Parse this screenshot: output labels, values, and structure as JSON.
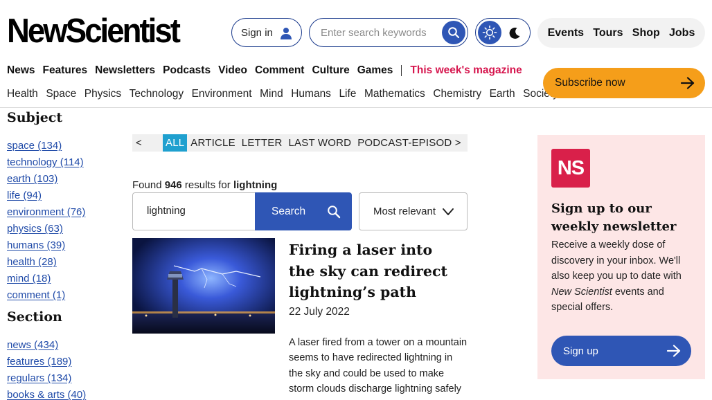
{
  "header": {
    "logo": "NewScientist",
    "sign_in": "Sign in",
    "search_placeholder": "Enter search keywords",
    "events_links": [
      "Events",
      "Tours",
      "Shop",
      "Jobs"
    ]
  },
  "main_nav": {
    "items": [
      "News",
      "Features",
      "Newsletters",
      "Podcasts",
      "Video",
      "Comment",
      "Culture",
      "Games"
    ],
    "magazine": "This week's magazine"
  },
  "sub_nav": [
    "Health",
    "Space",
    "Physics",
    "Technology",
    "Environment",
    "Mind",
    "Humans",
    "Life",
    "Mathematics",
    "Chemistry",
    "Earth",
    "Society"
  ],
  "subscribe": "Subscribe now",
  "facets": {
    "subject_title": "Subject",
    "subjects": [
      "space (134)",
      "technology (114)",
      "earth (103)",
      "life (94)",
      "environment (76)",
      "physics (63)",
      "humans (39)",
      "health (28)",
      "mind (18)",
      "comment (1)"
    ],
    "section_title": "Section",
    "sections": [
      "news (434)",
      "features (189)",
      "regulars (134)",
      "books & arts (40)"
    ]
  },
  "type_tabs": {
    "prev": "<",
    "tabs": [
      "ALL",
      "ARTICLE",
      "LETTER",
      "LAST WORD",
      "PODCAST-EPISOD >"
    ]
  },
  "results": {
    "found_prefix": "Found",
    "count": "946",
    "results_for": "results for",
    "query": "lightning",
    "search_button": "Search",
    "sort": "Most relevant"
  },
  "result_card": {
    "title": "Firing a laser into the sky can redirect lightning’s path",
    "date": "22 July 2022",
    "description": "A laser fired from a tower on a mountain seems to have redirected lightning in the sky and could be used to make storm clouds discharge lightning safely"
  },
  "newsletter": {
    "logo": "NS",
    "title": "Sign up to our weekly newsletter",
    "text_before": "Receive a weekly dose of discovery in your inbox. We'll also keep you up to date with ",
    "text_em": "New Scientist",
    "text_after": " events and special offers.",
    "button": "Sign up"
  },
  "colors": {
    "accent_blue": "#2f56b5",
    "link_blue": "#1f4aa8",
    "magazine_red": "#d6164e",
    "subscribe_orange": "#f59e1a",
    "active_tab": "#1fa0cf",
    "newsletter_bg": "#fde6e6",
    "ns_logo_red": "#d9204a"
  }
}
